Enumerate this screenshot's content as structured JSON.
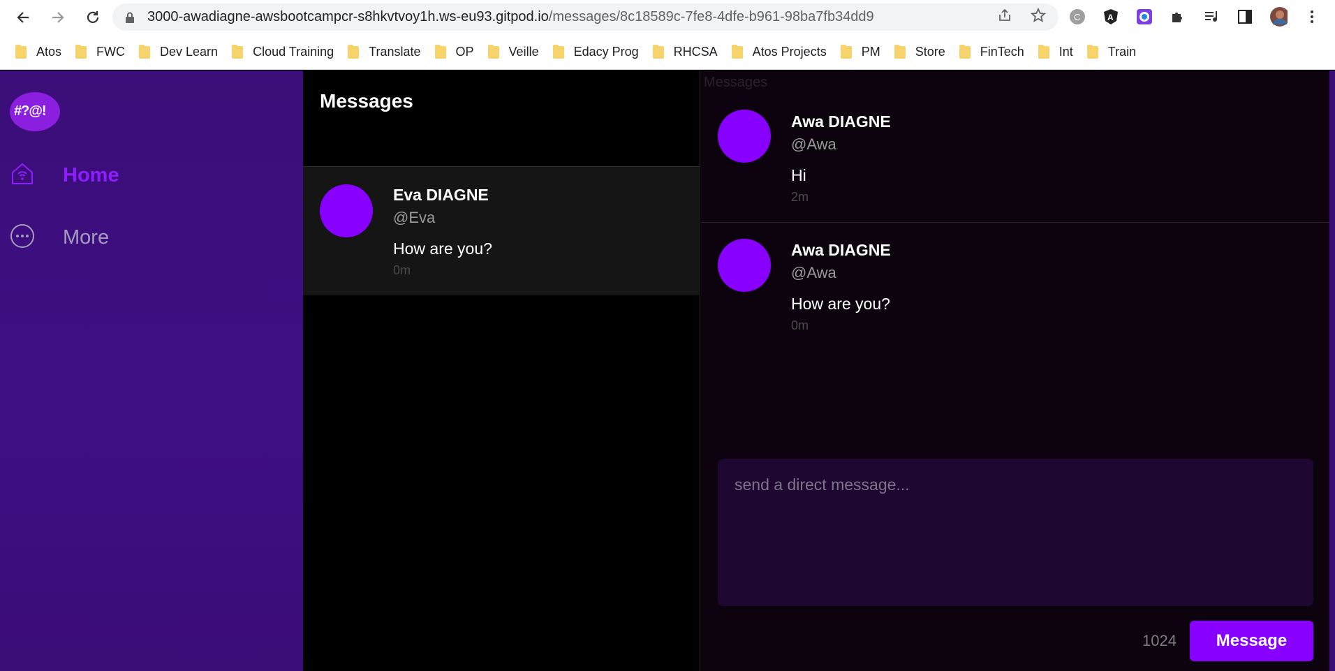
{
  "browser": {
    "url_host": "3000-awadiagne-awsbootcampcr-s8hkvtvoy1h.ws-eu93.gitpod.io",
    "url_path": "/messages/8c18589c-7fe8-4dfe-b961-98ba7fb34dd9",
    "bookmarks": [
      "Atos",
      "FWC",
      "Dev Learn",
      "Cloud Training",
      "Translate",
      "OP",
      "Veille",
      "Edacy Prog",
      "RHCSA",
      "Atos Projects",
      "PM",
      "Store",
      "FinTech",
      "Int",
      "Train"
    ]
  },
  "sidebar": {
    "logo_text": "#?@!",
    "items": [
      {
        "label": "Home",
        "icon": "home-icon"
      },
      {
        "label": "More",
        "icon": "more-icon"
      }
    ]
  },
  "list": {
    "title": "Messages",
    "conversations": [
      {
        "name": "Eva DIAGNE",
        "handle": "@Eva",
        "message": "How are you?",
        "ago": "0m"
      }
    ]
  },
  "thread": {
    "title": "Messages",
    "messages": [
      {
        "name": "Awa DIAGNE",
        "handle": "@Awa",
        "message": "Hi",
        "ago": "2m"
      },
      {
        "name": "Awa DIAGNE",
        "handle": "@Awa",
        "message": "How are you?",
        "ago": "0m"
      }
    ],
    "composer": {
      "placeholder": "send a direct message...",
      "count": "1024",
      "send_label": "Message"
    }
  },
  "colors": {
    "accent": "#8800ff",
    "sidebar": "#3c0e7a"
  }
}
